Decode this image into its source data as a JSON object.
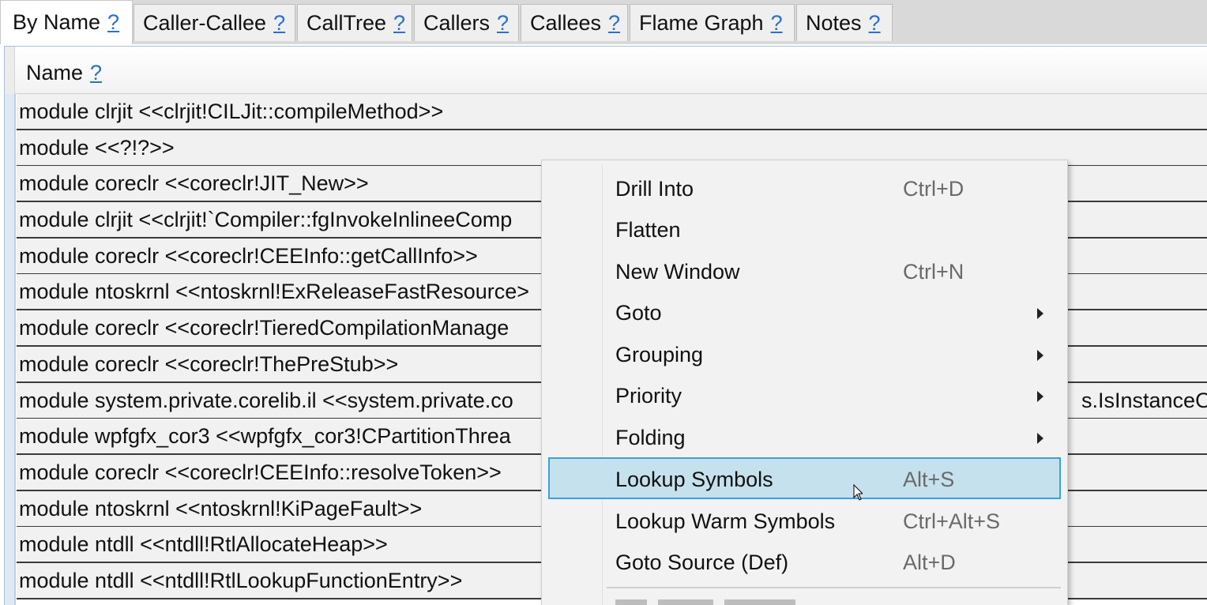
{
  "tabs": [
    {
      "label": "By Name",
      "help": "?",
      "active": true
    },
    {
      "label": "Caller-Callee",
      "help": "?"
    },
    {
      "label": "CallTree",
      "help": "?"
    },
    {
      "label": "Callers",
      "help": "?"
    },
    {
      "label": "Callees",
      "help": "?"
    },
    {
      "label": "Flame Graph",
      "help": "?"
    },
    {
      "label": "Notes",
      "help": "?"
    }
  ],
  "grid": {
    "column_header": {
      "label": "Name",
      "help": "?"
    },
    "rows": [
      {
        "name": "module clrjit <<clrjit!CILJit::compileMethod>>"
      },
      {
        "name": "module  <<?!?>>"
      },
      {
        "name": "module coreclr <<coreclr!JIT_New>>"
      },
      {
        "name": "module clrjit <<clrjit!`Compiler::fgInvokeInlineeComp"
      },
      {
        "name": "module coreclr <<coreclr!CEEInfo::getCallInfo>>"
      },
      {
        "name": "module ntoskrnl <<ntoskrnl!ExReleaseFastResource>"
      },
      {
        "name": "module coreclr <<coreclr!TieredCompilationManage"
      },
      {
        "name": "module coreclr <<coreclr!ThePreStub>>"
      },
      {
        "name": "module system.private.corelib.il <<system.private.co",
        "tail": "s.IsInstanceOfC"
      },
      {
        "name": "module wpfgfx_cor3 <<wpfgfx_cor3!CPartitionThrea"
      },
      {
        "name": "module coreclr <<coreclr!CEEInfo::resolveToken>>"
      },
      {
        "name": "module ntoskrnl <<ntoskrnl!KiPageFault>>"
      },
      {
        "name": "module ntdll <<ntdll!RtlAllocateHeap>>"
      },
      {
        "name": "module ntdll <<ntdll!RtlLookupFunctionEntry>>"
      }
    ]
  },
  "context_menu": {
    "items": [
      {
        "label": "Drill Into",
        "shortcut": "Ctrl+D"
      },
      {
        "label": "Flatten",
        "shortcut": ""
      },
      {
        "label": "New Window",
        "shortcut": "Ctrl+N"
      },
      {
        "label": "Goto",
        "shortcut": "",
        "submenu": true
      },
      {
        "label": "Grouping",
        "shortcut": "",
        "submenu": true
      },
      {
        "label": "Priority",
        "shortcut": "",
        "submenu": true
      },
      {
        "label": "Folding",
        "shortcut": "",
        "submenu": true
      },
      {
        "label": "Lookup Symbols",
        "shortcut": "Alt+S",
        "highlighted": true
      },
      {
        "label": "Lookup Warm Symbols",
        "shortcut": "Ctrl+Alt+S"
      },
      {
        "label": "Goto Source (Def)",
        "shortcut": "Alt+D"
      }
    ]
  },
  "colors": {
    "highlight_fill": "#c6e1ee",
    "highlight_border": "#3aa0e0",
    "help_link": "#2a6fd0"
  }
}
